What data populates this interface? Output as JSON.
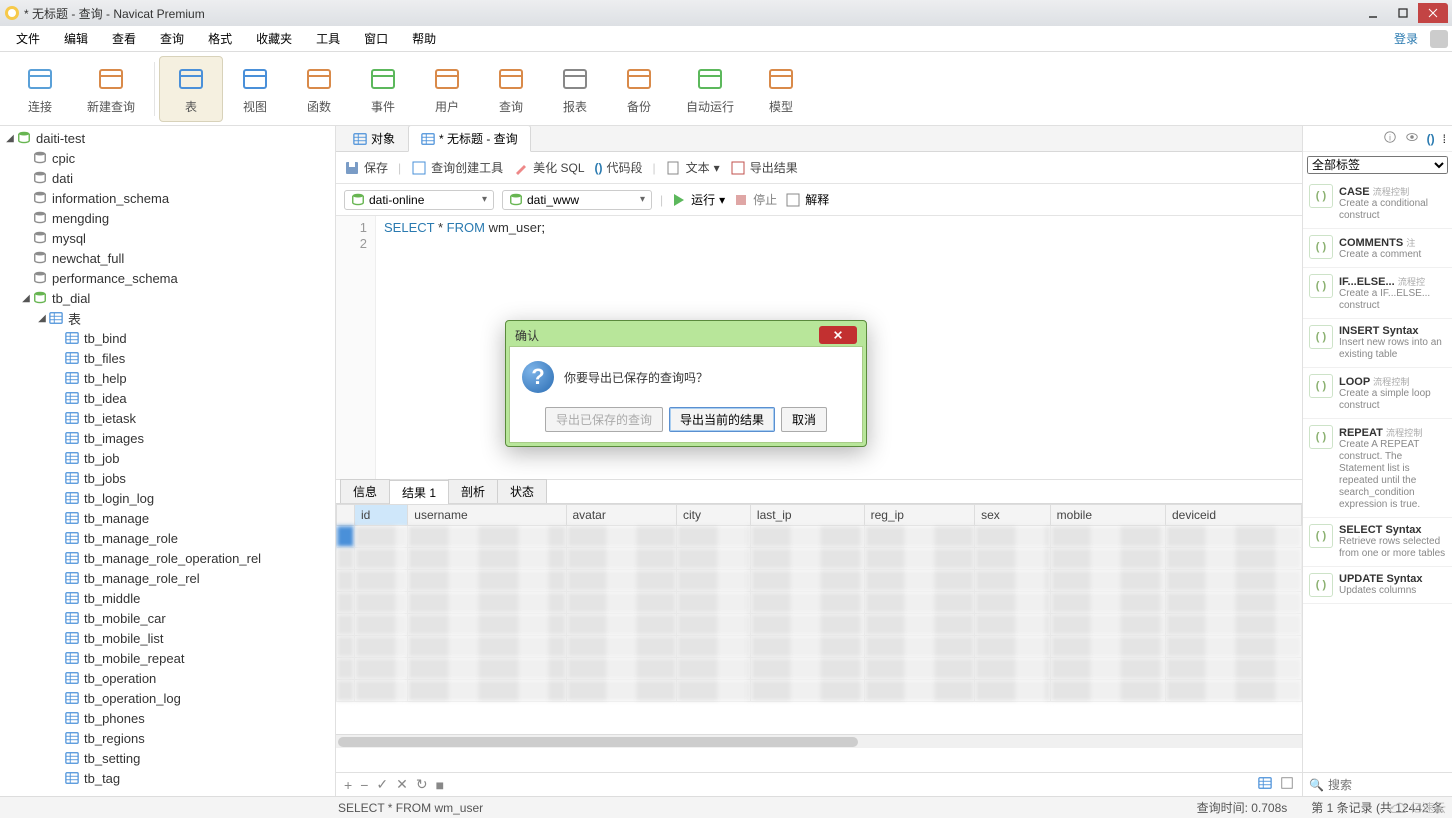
{
  "title": "* 无标题 - 查询 - Navicat Premium",
  "menu": [
    "文件",
    "编辑",
    "查看",
    "查询",
    "格式",
    "收藏夹",
    "工具",
    "窗口",
    "帮助"
  ],
  "login_label": "登录",
  "ribbon": [
    {
      "label": "连接",
      "icon": "connect"
    },
    {
      "label": "新建查询",
      "icon": "newquery"
    },
    {
      "label": "表",
      "icon": "table",
      "selected": true
    },
    {
      "label": "视图",
      "icon": "view"
    },
    {
      "label": "函数",
      "icon": "fx"
    },
    {
      "label": "事件",
      "icon": "event"
    },
    {
      "label": "用户",
      "icon": "user"
    },
    {
      "label": "查询",
      "icon": "query"
    },
    {
      "label": "报表",
      "icon": "report"
    },
    {
      "label": "备份",
      "icon": "backup"
    },
    {
      "label": "自动运行",
      "icon": "autorun"
    },
    {
      "label": "模型",
      "icon": "model"
    }
  ],
  "tree": {
    "root": "daiti-test",
    "databases": [
      "cpic",
      "dati",
      "information_schema",
      "mengding",
      "mysql",
      "newchat_full",
      "performance_schema"
    ],
    "open_db": "tb_dial",
    "tables_group": "表",
    "tables": [
      "tb_bind",
      "tb_files",
      "tb_help",
      "tb_idea",
      "tb_ietask",
      "tb_images",
      "tb_job",
      "tb_jobs",
      "tb_login_log",
      "tb_manage",
      "tb_manage_role",
      "tb_manage_role_operation_rel",
      "tb_manage_role_rel",
      "tb_middle",
      "tb_mobile_car",
      "tb_mobile_list",
      "tb_mobile_repeat",
      "tb_operation",
      "tb_operation_log",
      "tb_phones",
      "tb_regions",
      "tb_setting",
      "tb_tag"
    ]
  },
  "tabs": {
    "obj": "对象",
    "query": "* 无标题 - 查询"
  },
  "qtb": {
    "save": "保存",
    "builder": "查询创建工具",
    "beautify": "美化 SQL",
    "snippet": "代码段",
    "text": "文本",
    "export": "导出结果"
  },
  "sel_conn": "dati-online",
  "sel_db": "dati_www",
  "actions": {
    "run": "运行",
    "stop": "停止",
    "explain": "解释"
  },
  "sql": "SELECT * FROM wm_user;",
  "restabs": [
    "信息",
    "结果 1",
    "剖析",
    "状态"
  ],
  "columns": [
    "id",
    "username",
    "avatar",
    "city",
    "last_ip",
    "reg_ip",
    "sex",
    "mobile",
    "deviceid"
  ],
  "status": {
    "sql": "SELECT * FROM wm_user",
    "time": "查询时间: 0.708s",
    "rec": "第 1 条记录 (共 12442 条"
  },
  "snippets": [
    {
      "t": "CASE",
      "tag": "流程控制",
      "d": "Create a conditional construct"
    },
    {
      "t": "COMMENTS",
      "tag": "注",
      "d": "Create a comment"
    },
    {
      "t": "IF...ELSE...",
      "tag": "流程控",
      "d": "Create a IF...ELSE... construct"
    },
    {
      "t": "INSERT Syntax",
      "tag": "",
      "d": "Insert new rows into an existing table"
    },
    {
      "t": "LOOP",
      "tag": "流程控制",
      "d": "Create a simple loop construct"
    },
    {
      "t": "REPEAT",
      "tag": "流程控制",
      "d": "Create A REPEAT construct. The Statement list is repeated until the search_condition expression is true."
    },
    {
      "t": "SELECT Syntax",
      "tag": "",
      "d": "Retrieve rows selected from one or more tables"
    },
    {
      "t": "UPDATE Syntax",
      "tag": "",
      "d": "Updates columns"
    }
  ],
  "snip_filter": "全部标签",
  "snip_search_ph": "搜索",
  "dialog": {
    "title": "确认",
    "msg": "你要导出已保存的查询吗？",
    "b1": "导出已保存的查询",
    "b2": "导出当前的结果",
    "b3": "取消"
  },
  "watermark": "亿速云"
}
